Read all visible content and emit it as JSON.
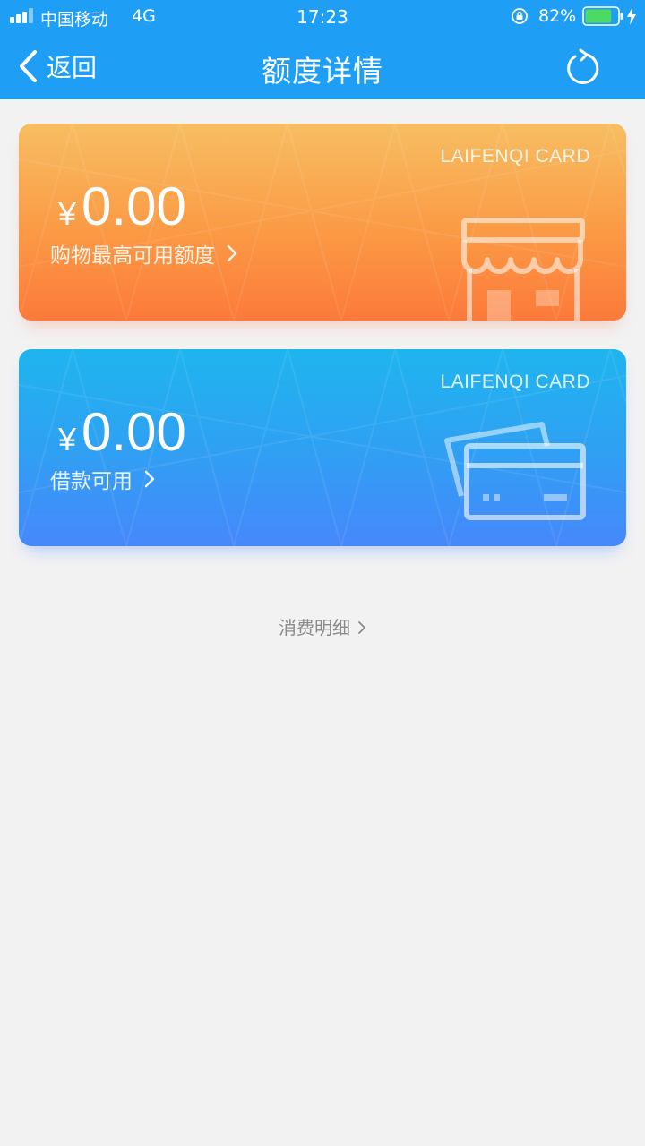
{
  "status_bar": {
    "carrier": "中国移动",
    "network": "4G",
    "time": "17:23",
    "battery": "82%",
    "battery_level": 0.82
  },
  "nav": {
    "back_label": "返回",
    "title": "额度详情",
    "refresh_icon": "refresh-icon"
  },
  "cards": [
    {
      "brand": "LAIFENQI CARD",
      "currency": "¥",
      "amount": "0.00",
      "link_label": "购物最高可用额度",
      "icon": "shop-icon",
      "color_top": "#f7be62",
      "color_bottom": "#fc7a3a"
    },
    {
      "brand": "LAIFENQI CARD",
      "currency": "¥",
      "amount": "0.00",
      "link_label": "借款可用",
      "icon": "credit-cards-icon",
      "color_top": "#1fb5ef",
      "color_bottom": "#4688fb"
    }
  ],
  "details_link": "消费明细",
  "colors": {
    "header": "#1e9ff5",
    "background": "#f2f2f3"
  }
}
